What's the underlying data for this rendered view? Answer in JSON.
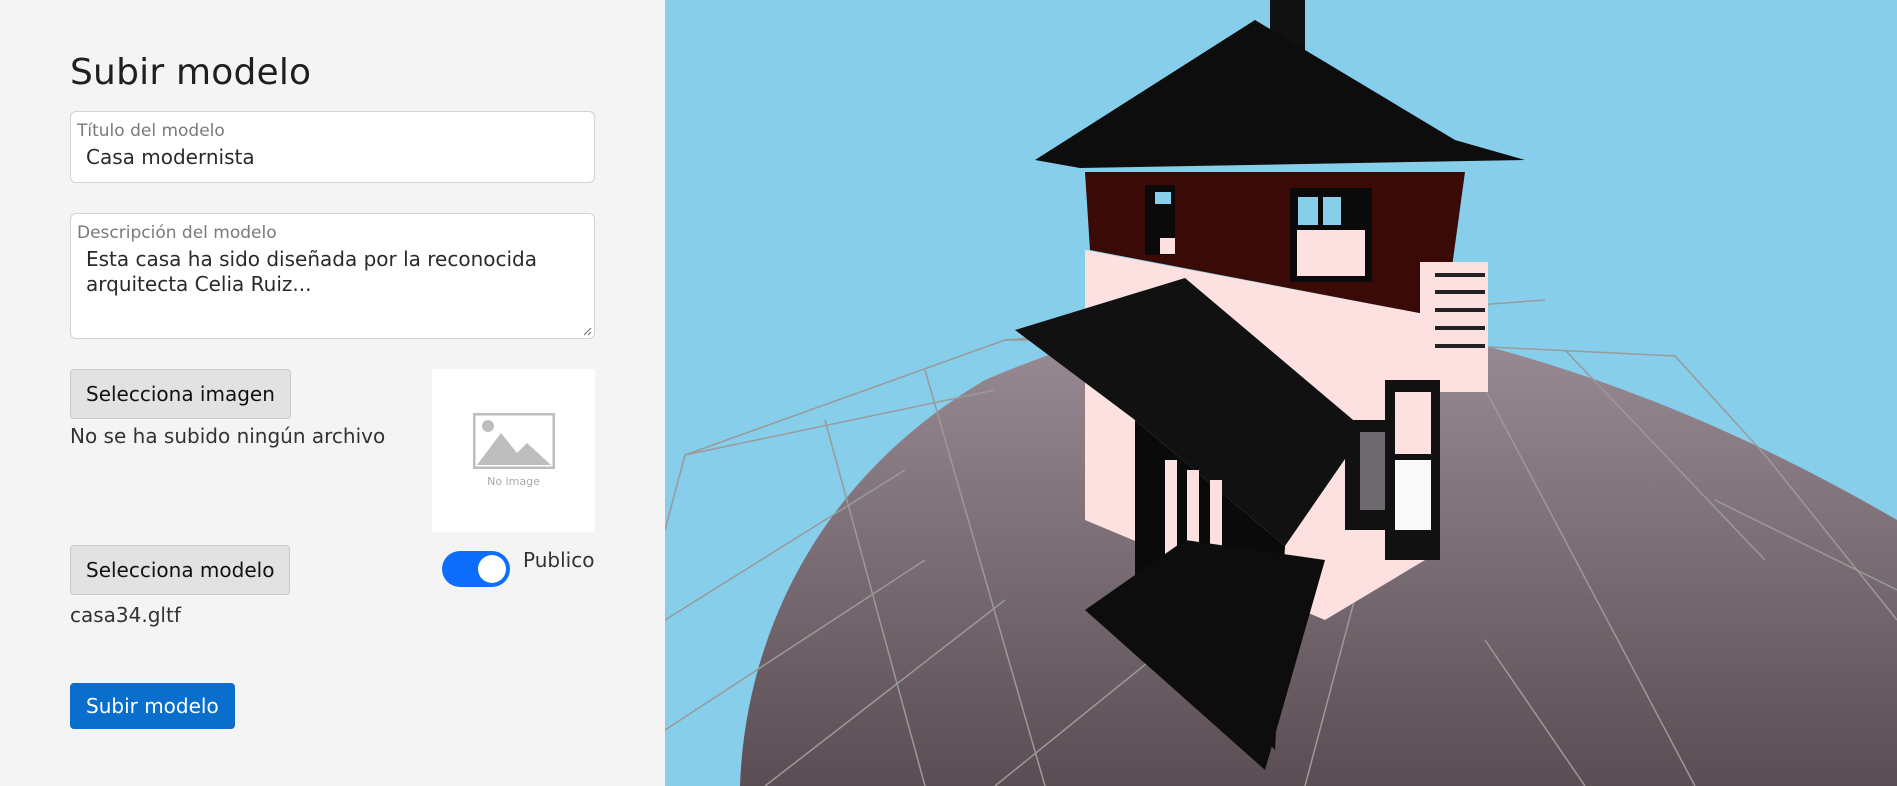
{
  "form": {
    "title": "Subir modelo",
    "model_title": {
      "label": "Título del modelo",
      "value": "Casa modernista"
    },
    "description": {
      "label": "Descripción del modelo",
      "value": "Esta casa ha sido diseñada por la reconocida arquitecta Celia Ruiz..."
    },
    "image": {
      "button_label": "Selecciona imagen",
      "status": "No se ha subido ningún archivo",
      "preview_placeholder": "No image"
    },
    "model": {
      "button_label": "Selecciona modelo",
      "filename": "casa34.gltf"
    },
    "public_toggle": {
      "label": "Publico",
      "checked": true
    },
    "submit_label": "Subir modelo"
  },
  "viewer": {
    "sky_color": "#87ceeb",
    "ground_color": "#7a6a72",
    "model_name": "casa34.gltf"
  },
  "icons": [
    "image-placeholder-icon",
    "resize-grip-icon"
  ],
  "colors": {
    "primary": "#0a6fcc",
    "toggle_on": "#0d6efd",
    "panel_bg": "#f4f4f4"
  }
}
